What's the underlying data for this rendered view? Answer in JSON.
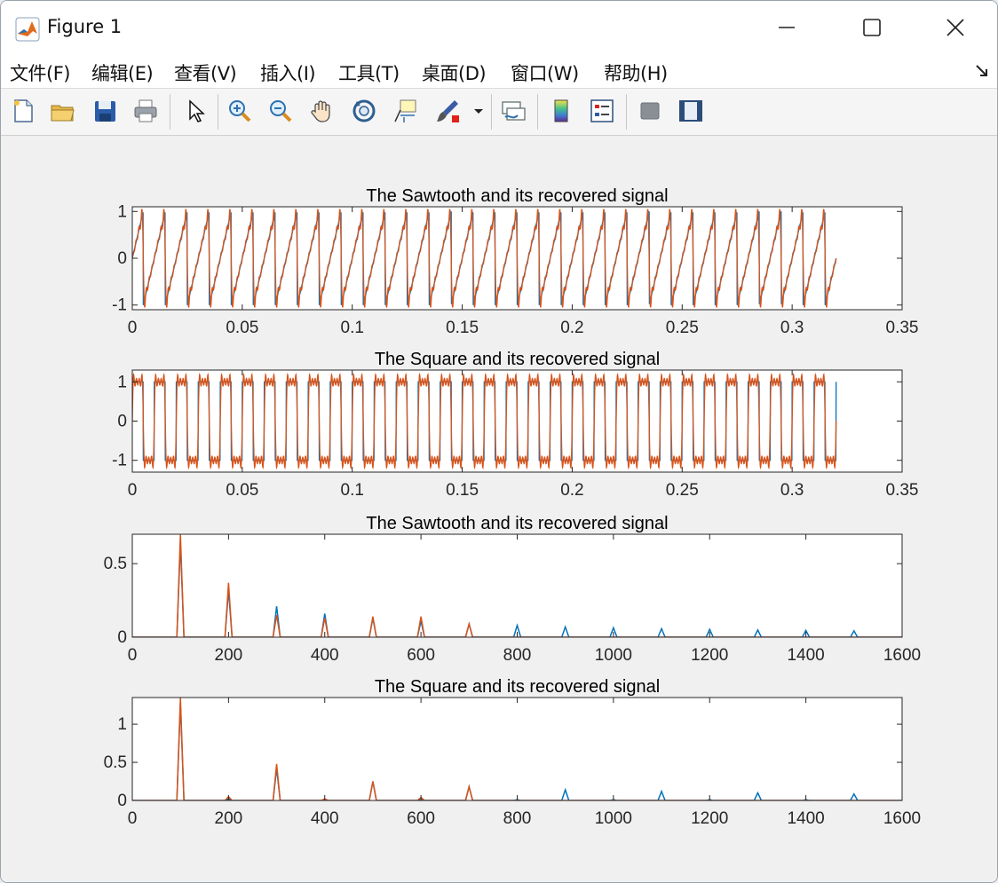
{
  "window": {
    "title": "Figure 1"
  },
  "menu": {
    "items": [
      {
        "label": "文件(F)"
      },
      {
        "label": "编辑(E)"
      },
      {
        "label": "查看(V)"
      },
      {
        "label": "插入(I)"
      },
      {
        "label": "工具(T)"
      },
      {
        "label": "桌面(D)"
      },
      {
        "label": "窗口(W)"
      },
      {
        "label": "帮助(H)"
      }
    ]
  },
  "toolbar": {
    "buttons": [
      {
        "icon": "new-figure-icon"
      },
      {
        "icon": "open-icon"
      },
      {
        "icon": "save-icon"
      },
      {
        "icon": "print-icon"
      },
      {
        "icon": "pointer-icon"
      },
      {
        "icon": "zoom-in-icon"
      },
      {
        "icon": "zoom-out-icon"
      },
      {
        "icon": "pan-icon"
      },
      {
        "icon": "rotate-3d-icon"
      },
      {
        "icon": "data-cursor-icon"
      },
      {
        "icon": "brush-icon"
      },
      {
        "icon": "link-plot-icon"
      },
      {
        "icon": "colorbar-icon"
      },
      {
        "icon": "legend-icon"
      },
      {
        "icon": "hide-plot-tools-icon"
      },
      {
        "icon": "show-plot-tools-icon"
      }
    ]
  },
  "colors": {
    "series_blue": "#0072BD",
    "series_orange": "#D95319"
  },
  "chart_data": [
    {
      "type": "line",
      "title": "The Sawtooth and its recovered signal",
      "xlim": [
        0,
        0.35
      ],
      "ylim": [
        -1.1,
        1.1
      ],
      "xticks": [
        "0",
        "0.05",
        "0.1",
        "0.15",
        "0.2",
        "0.25",
        "0.3",
        "0.35"
      ],
      "yticks": [
        "-1",
        "0",
        "1"
      ],
      "signal": {
        "waveform": "sawtooth",
        "frequency_hz": 100,
        "x_end": 0.32,
        "recovered_harmonics": 7
      },
      "series": [
        {
          "color": "#0072BD"
        },
        {
          "color": "#D95319"
        }
      ]
    },
    {
      "type": "line",
      "title": "The Square and its recovered signal",
      "xlim": [
        0,
        0.35
      ],
      "ylim": [
        -1.3,
        1.3
      ],
      "xticks": [
        "0",
        "0.05",
        "0.1",
        "0.15",
        "0.2",
        "0.25",
        "0.3",
        "0.35"
      ],
      "yticks": [
        "-1",
        "0",
        "1"
      ],
      "signal": {
        "waveform": "square",
        "frequency_hz": 100,
        "x_end": 0.32,
        "recovered_harmonics": 7
      },
      "series": [
        {
          "color": "#0072BD"
        },
        {
          "color": "#D95319"
        }
      ]
    },
    {
      "type": "line",
      "title": "The Sawtooth and its recovered signal",
      "xlim": [
        0,
        1600
      ],
      "ylim": [
        0,
        0.7
      ],
      "xticks": [
        "0",
        "200",
        "400",
        "600",
        "800",
        "1000",
        "1200",
        "1400",
        "1600"
      ],
      "yticks": [
        "0",
        "0.5"
      ],
      "series": [
        {
          "color": "#0072BD",
          "x": [
            100,
            200,
            300,
            400,
            500,
            600,
            700,
            800,
            900,
            1000,
            1100,
            1200,
            1300,
            1400,
            1500
          ],
          "y": [
            0.64,
            0.32,
            0.21,
            0.16,
            0.13,
            0.11,
            0.09,
            0.08,
            0.07,
            0.064,
            0.058,
            0.053,
            0.049,
            0.046,
            0.043
          ]
        },
        {
          "color": "#D95319",
          "x": [
            100,
            200,
            300,
            400,
            500,
            600,
            700
          ],
          "y": [
            0.7,
            0.37,
            0.15,
            0.13,
            0.14,
            0.14,
            0.09
          ]
        }
      ]
    },
    {
      "type": "line",
      "title": "The Square and its recovered signal",
      "xlim": [
        0,
        1600
      ],
      "ylim": [
        0,
        1.35
      ],
      "xticks": [
        "0",
        "200",
        "400",
        "600",
        "800",
        "1000",
        "1200",
        "1400",
        "1600"
      ],
      "yticks": [
        "0",
        "0.5",
        "1"
      ],
      "series": [
        {
          "color": "#0072BD",
          "x": [
            100,
            200,
            300,
            400,
            500,
            600,
            700,
            800,
            900,
            1000,
            1100,
            1200,
            1300,
            1400,
            1500
          ],
          "y": [
            1.27,
            0.02,
            0.42,
            0.01,
            0.25,
            0.01,
            0.18,
            0.01,
            0.14,
            0.01,
            0.12,
            0.01,
            0.1,
            0.01,
            0.085
          ]
        },
        {
          "color": "#D95319",
          "x": [
            100,
            200,
            300,
            400,
            500,
            600,
            700
          ],
          "y": [
            1.35,
            0.05,
            0.48,
            0.02,
            0.25,
            0.04,
            0.18
          ]
        }
      ]
    }
  ]
}
